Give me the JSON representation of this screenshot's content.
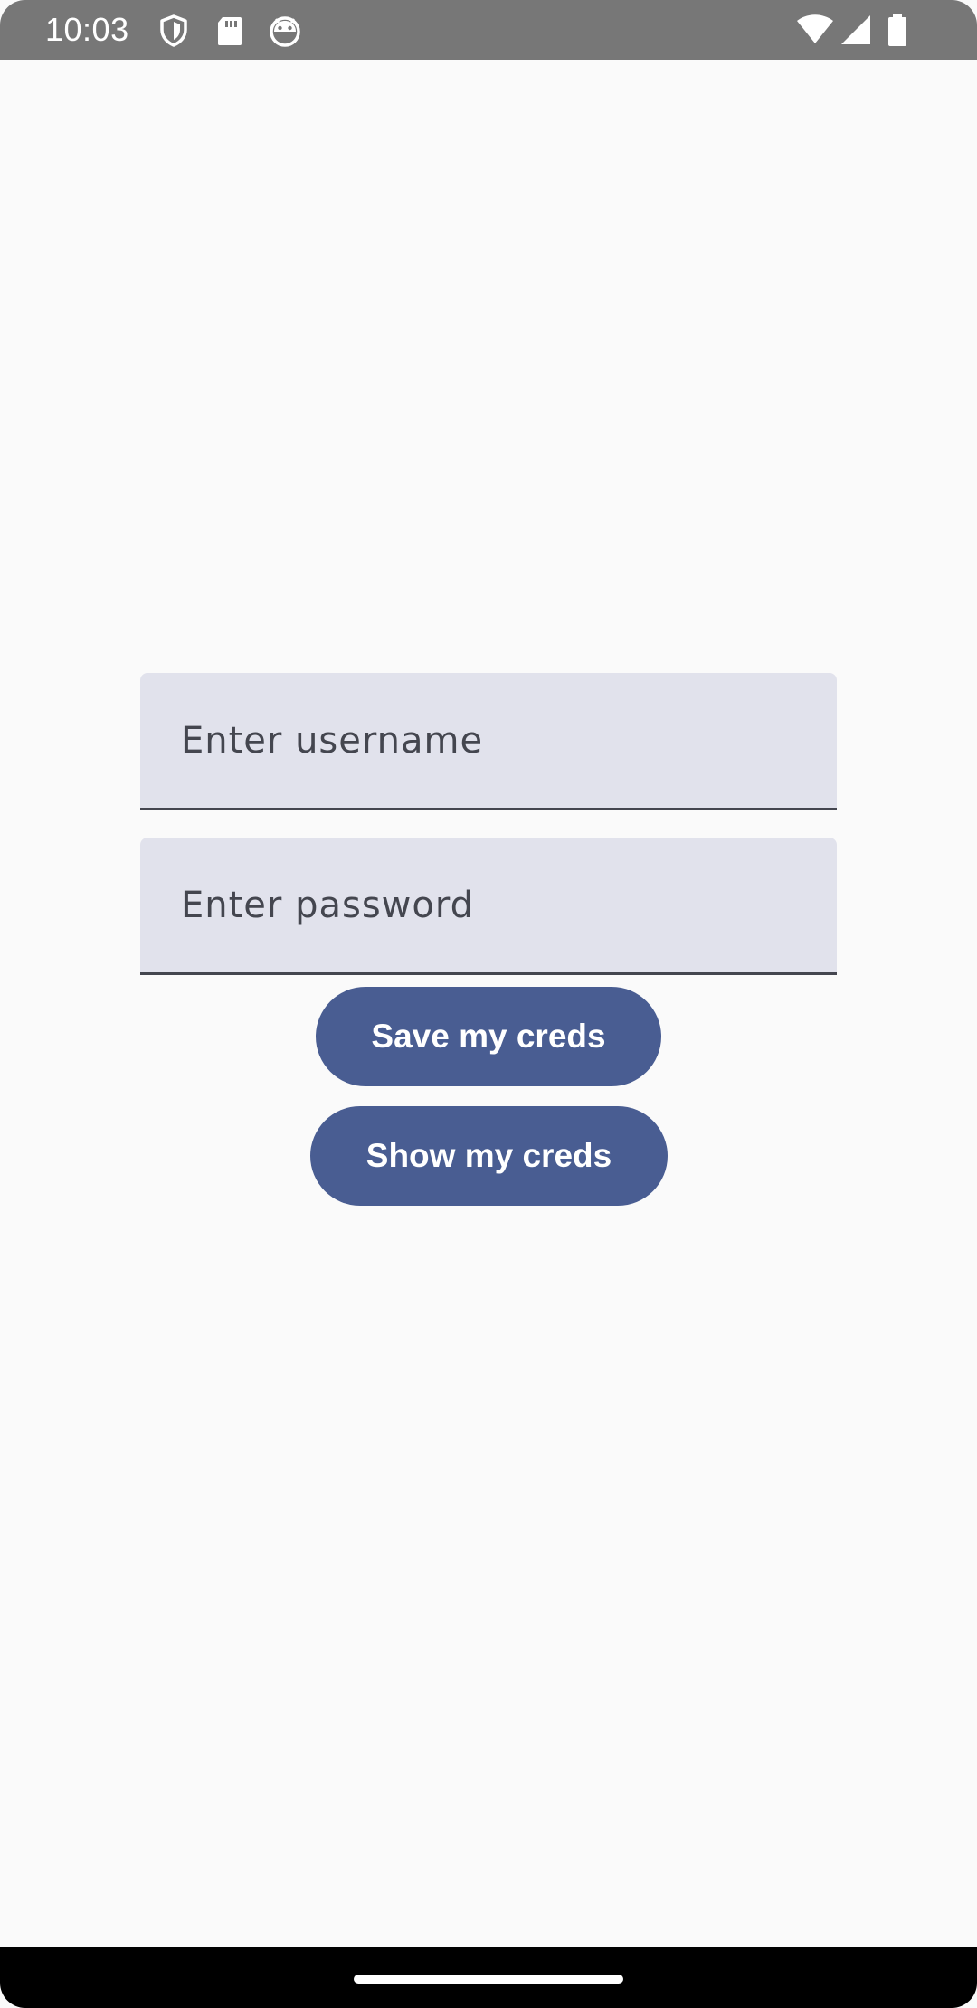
{
  "status_bar": {
    "time": "10:03",
    "left_icons": [
      "shield-icon",
      "sd-card-icon",
      "android-face-icon"
    ],
    "right_icons": [
      "wifi-icon",
      "cell-signal-icon",
      "battery-icon"
    ],
    "background": "#777777"
  },
  "form": {
    "username": {
      "placeholder": "Enter username",
      "value": ""
    },
    "password": {
      "placeholder": "Enter password",
      "value": ""
    },
    "save_button_label": "Save my creds",
    "show_button_label": "Show my creds"
  },
  "colors": {
    "background": "#fafafa",
    "field_background": "#e1e2ec",
    "field_underline": "#44464f",
    "button_background": "#495d92",
    "button_text": "#ffffff"
  },
  "nav_bar": {
    "handle": "home-gesture-handle"
  }
}
